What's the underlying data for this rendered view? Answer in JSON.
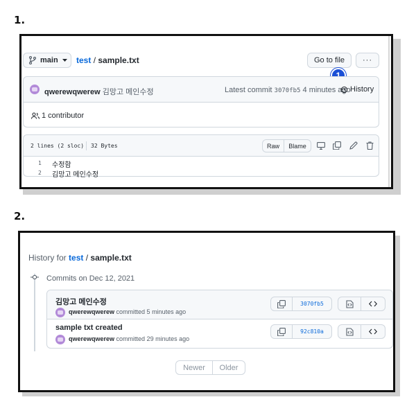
{
  "steps": {
    "step1": "1.",
    "step2": "2."
  },
  "file_view": {
    "branch": "main",
    "breadcrumb_repo": "test",
    "breadcrumb_sep": "/",
    "breadcrumb_file": "sample.txt",
    "go_to_file": "Go to file",
    "more": "···",
    "callout_number": "1",
    "commit_author": "qwerewqwerew",
    "commit_message": "김망고 메인수정",
    "latest_commit_label": "Latest commit",
    "commit_sha": "3070fb5",
    "commit_time": "4 minutes ago",
    "history": "History",
    "contributors": "1 contributor",
    "file_lines": "2 lines (2 sloc)",
    "file_size": "32 Bytes",
    "raw": "Raw",
    "blame": "Blame",
    "code": [
      {
        "num": "1",
        "text": "수정함"
      },
      {
        "num": "2",
        "text": "김망고 메인수정"
      }
    ]
  },
  "history_view": {
    "title_prefix": "History for",
    "repo": "test",
    "sep": "/",
    "file": "sample.txt",
    "commits_heading": "Commits on Dec 12, 2021",
    "commits": [
      {
        "message": "김망고 메인수정",
        "author": "qwerewqwerew",
        "meta": "committed 5 minutes ago",
        "sha": "3070fb5"
      },
      {
        "message": "sample txt created",
        "author": "qwerewqwerew",
        "meta": "committed 29 minutes ago",
        "sha": "92c810a"
      }
    ],
    "newer": "Newer",
    "older": "Older"
  },
  "colors": {
    "accent": "#0969da",
    "border": "#d0d7de",
    "header_bg": "#f6f8fa",
    "muted": "#57606a"
  }
}
